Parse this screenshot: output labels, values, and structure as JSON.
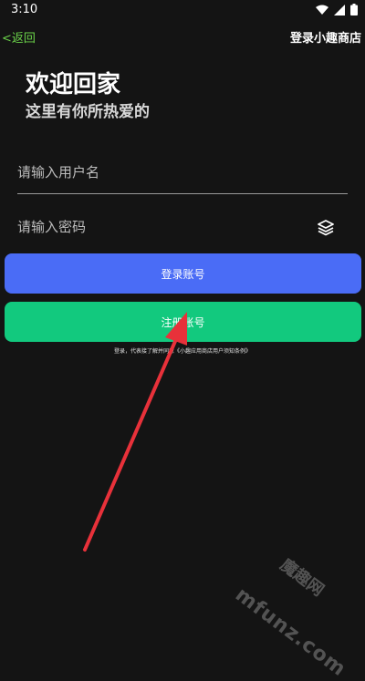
{
  "status_bar": {
    "time": "3:10"
  },
  "top_bar": {
    "back_label": "<返回",
    "title": "登录小趣商店"
  },
  "welcome": {
    "title": "欢迎回家",
    "subtitle": "这里有你所热爱的"
  },
  "form": {
    "username_placeholder": "请输入用户名",
    "password_placeholder": "请输入密码",
    "login_label": "登录账号",
    "register_label": "注册账号",
    "terms": "登录，代表接了解并同意《小趣应用商店用户须知条例》"
  },
  "watermark": {
    "text": "mfunz.com",
    "text_cn": "魔趣网"
  },
  "colors": {
    "back_link": "#6BD34A",
    "login_button": "#4A6CF6",
    "register_button": "#12C97E",
    "arrow": "#E8313A"
  }
}
